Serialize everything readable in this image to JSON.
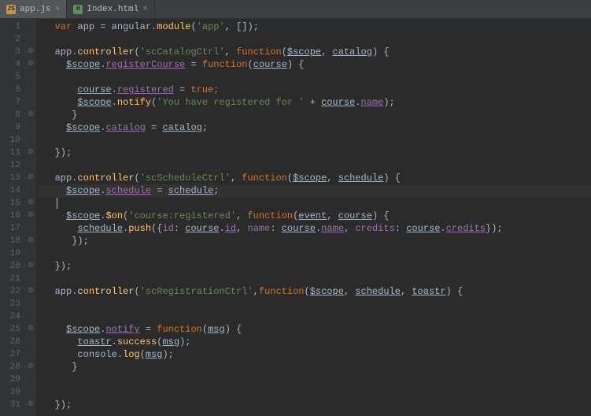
{
  "tabs": [
    {
      "label": "app.js",
      "icon": "js",
      "active": true
    },
    {
      "label": "Index.html",
      "icon": "html",
      "active": false
    }
  ],
  "gutter_start": 1,
  "gutter_end": 31,
  "fold_markers": {
    "3": "⊟",
    "4": "⊟",
    "8": "⊟",
    "11": "⊟",
    "13": "⊟",
    "15": "⊟",
    "16": "⊟",
    "18": "⊟",
    "20": "⊟",
    "22": "⊟",
    "25": "⊟",
    "28": "⊟",
    "31": "⊟"
  },
  "code": {
    "l1": {
      "a": "var",
      "b": " app = angular.",
      "c": "module",
      "d": "(",
      "e": "'app'",
      "f": ", []);"
    },
    "l3": {
      "a": "app.",
      "b": "controller",
      "c": "(",
      "d": "'scCatalogCtrl'",
      "e": ", ",
      "f": "function",
      "g": "(",
      "h": "$scope",
      "i": ", ",
      "j": "catalog",
      "k": ") {"
    },
    "l4": {
      "a": "$scope",
      "b": ".",
      "c": "registerCourse",
      "d": " = ",
      "e": "function",
      "f": "(",
      "g": "course",
      "h": ") {"
    },
    "l6": {
      "a": "course",
      "b": ".",
      "c": "registered",
      "d": " = ",
      "e": "true",
      "f": ";"
    },
    "l7": {
      "a": "$scope",
      "b": ".",
      "c": "notify",
      "d": "(",
      "e": "'You have registered for '",
      "f": " + ",
      "g": "course",
      "h": ".",
      "i": "name",
      "j": ");"
    },
    "l8": {
      "a": "}"
    },
    "l9": {
      "a": "$scope",
      "b": ".",
      "c": "catalog",
      "d": " = ",
      "e": "catalog",
      "f": ";"
    },
    "l11": {
      "a": "});"
    },
    "l13": {
      "a": "app.",
      "b": "controller",
      "c": "(",
      "d": "'scScheduleCtrl'",
      "e": ", ",
      "f": "function",
      "g": "(",
      "h": "$scope",
      "i": ", ",
      "j": "schedule",
      "k": ") {"
    },
    "l14": {
      "a": "$scope",
      "b": ".",
      "c": "schedule",
      "d": " = ",
      "e": "schedule",
      "f": ";"
    },
    "l16": {
      "a": "$scope",
      "b": ".",
      "c": "$on",
      "d": "(",
      "e": "'course:registered'",
      "f": ", ",
      "g": "function",
      "h": "(",
      "i": "event",
      "j": ", ",
      "k": "course",
      "l": ") {"
    },
    "l17": {
      "a": "schedule",
      "b": ".",
      "c": "push",
      "d": "({",
      "e": "id",
      "f": ": ",
      "g": "course",
      "h": ".",
      "i": "id",
      "j": ", ",
      "k": "name",
      "l": ": ",
      "m": "course",
      "n": ".",
      "o": "name",
      "p": ", ",
      "q": "credits",
      "r": ": ",
      "s": "course",
      "t": ".",
      "u": "credits",
      "v": "});"
    },
    "l18": {
      "a": "});"
    },
    "l20": {
      "a": "});"
    },
    "l22": {
      "a": "app.",
      "b": "controller",
      "c": "(",
      "d": "'scRegistrationCtrl'",
      "e": ",",
      "f": "function",
      "g": "(",
      "h": "$scope",
      "i": ", ",
      "j": "schedule",
      "k": ", ",
      "l": "toastr",
      "m": ") {"
    },
    "l25": {
      "a": "$scope",
      "b": ".",
      "c": "notify",
      "d": " = ",
      "e": "function",
      "f": "(",
      "g": "msg",
      "h": ") {"
    },
    "l26": {
      "a": "toastr",
      "b": ".",
      "c": "success",
      "d": "(",
      "e": "msg",
      "f": ");"
    },
    "l27": {
      "a": "console.",
      "b": "log",
      "c": "(",
      "d": "msg",
      "e": ");"
    },
    "l28": {
      "a": "}"
    },
    "l31": {
      "a": "});"
    }
  }
}
